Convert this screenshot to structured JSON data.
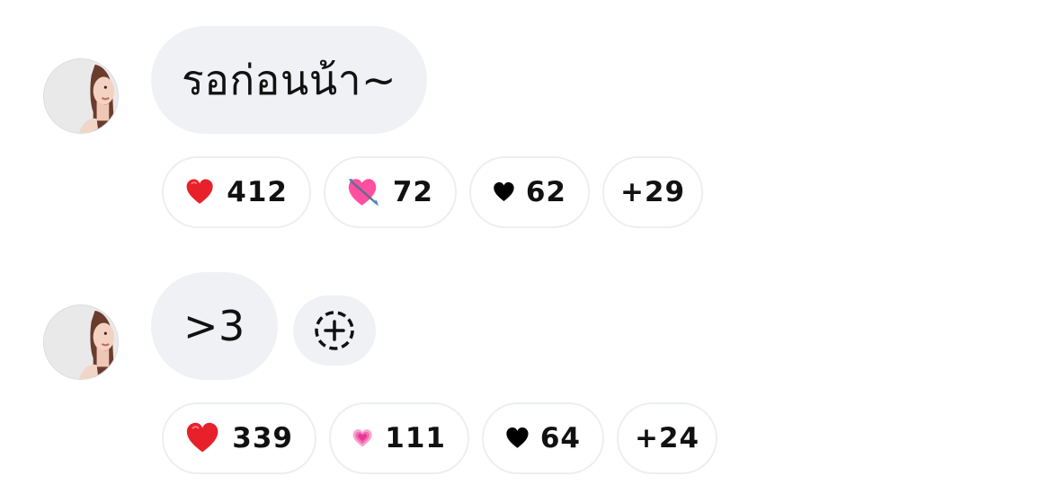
{
  "messages": [
    {
      "text": "รอก่อนน้า~",
      "reactions": [
        {
          "icon": "red-heart-emoji",
          "count": "412"
        },
        {
          "icon": "heart-with-arrow-emoji",
          "count": "72"
        },
        {
          "icon": "black-heart-icon",
          "count": "62"
        },
        {
          "icon": null,
          "count": "+29"
        }
      ]
    },
    {
      "text": ">3",
      "reactions": [
        {
          "icon": "red-heart-emoji",
          "count": "339"
        },
        {
          "icon": "growing-heart-emoji",
          "count": "111"
        },
        {
          "icon": "black-heart-icon",
          "count": "64"
        },
        {
          "icon": null,
          "count": "+24"
        }
      ]
    }
  ],
  "colors": {
    "bubble_bg": "#eff1f4",
    "chip_border": "#eceef1",
    "text": "#111111"
  }
}
